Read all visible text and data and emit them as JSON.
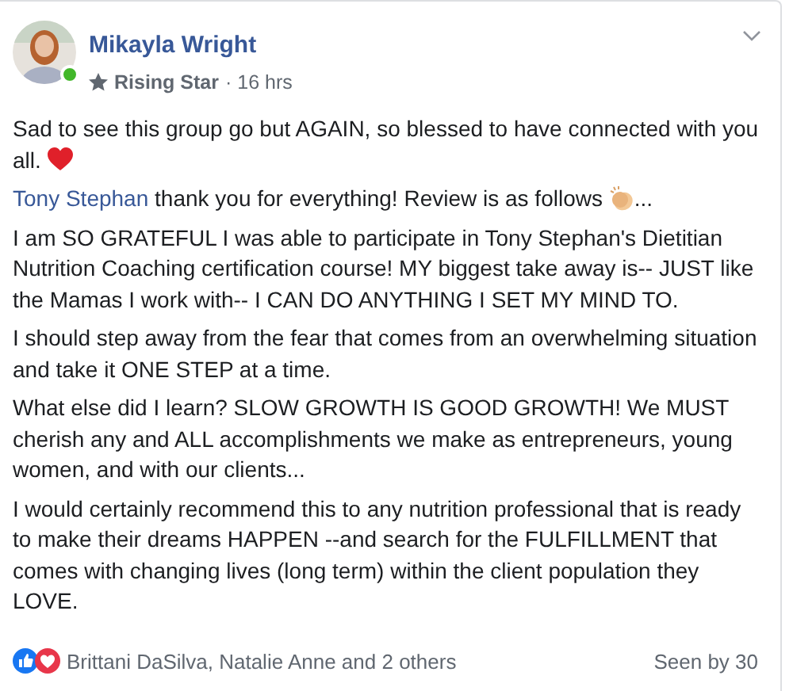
{
  "post": {
    "author": "Mikayla Wright",
    "online": true,
    "badge": "Rising Star",
    "time": "· 16 hrs",
    "paragraphs": [
      [
        {
          "kind": "text",
          "text": "Sad to see this group go but AGAIN, so blessed to have connected with you all. "
        },
        {
          "kind": "heart"
        }
      ],
      [
        {
          "kind": "mention",
          "text": "Tony Stephan"
        },
        {
          "kind": "text",
          "text": " thank you for everything! Review is as follows "
        },
        {
          "kind": "clap"
        },
        {
          "kind": "text",
          "text": "..."
        }
      ],
      [
        {
          "kind": "text",
          "text": "I am SO GRATEFUL I was able to participate in Tony Stephan's Dietitian Nutrition Coaching certification course! MY biggest take away is-- JUST like the Mamas I work with-- I CAN DO ANYTHING I SET MY MIND TO."
        }
      ],
      [
        {
          "kind": "text",
          "text": "I should step away from the fear that comes from an overwhelming situation and take it ONE STEP at a time."
        }
      ],
      [
        {
          "kind": "text",
          "text": "What else did I learn? SLOW GROWTH IS GOOD GROWTH! We MUST cherish any and ALL accomplishments we make as entrepreneurs, young women, and with our clients..."
        }
      ],
      [
        {
          "kind": "text",
          "text": "I would certainly recommend this to any nutrition professional that is ready to make their dreams HAPPEN --and search for the FULFILLMENT that comes with changing lives (long term) within the client population they LOVE."
        }
      ]
    ],
    "reactions": "Brittani DaSilva, Natalie Anne and 2 others",
    "seen": "Seen by 30"
  }
}
